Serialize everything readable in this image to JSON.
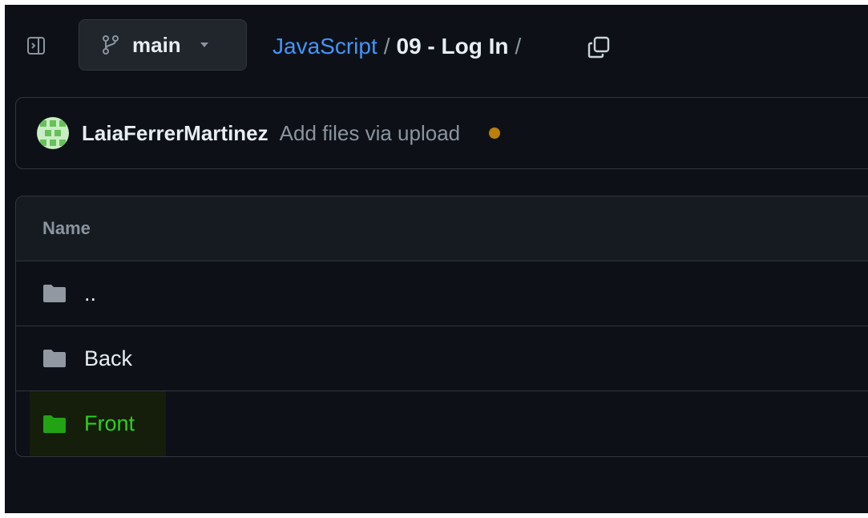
{
  "topbar": {
    "branch": {
      "icon": "git-branch-icon",
      "label": "main"
    },
    "breadcrumb": {
      "repo": "JavaScript",
      "separator": "/",
      "current": "09 - Log In",
      "trailing_separator": "/"
    },
    "copy_icon": "copy-icon",
    "panel_toggle_icon": "sidebar-expand-icon"
  },
  "commit": {
    "author": "LaiaFerrerMartinez",
    "message": "Add files via upload",
    "status_color": "#bb8009"
  },
  "files": {
    "header": "Name",
    "rows": [
      {
        "name": "..",
        "icon": "folder-icon"
      },
      {
        "name": "Back",
        "icon": "folder-icon"
      },
      {
        "name": "Front",
        "icon": "folder-icon",
        "highlight_color": "#2bd11a"
      }
    ]
  },
  "colors": {
    "background": "#0d1117",
    "border": "#30363d",
    "link": "#4493f8",
    "muted": "#8b949e",
    "text": "#e6edf3"
  }
}
